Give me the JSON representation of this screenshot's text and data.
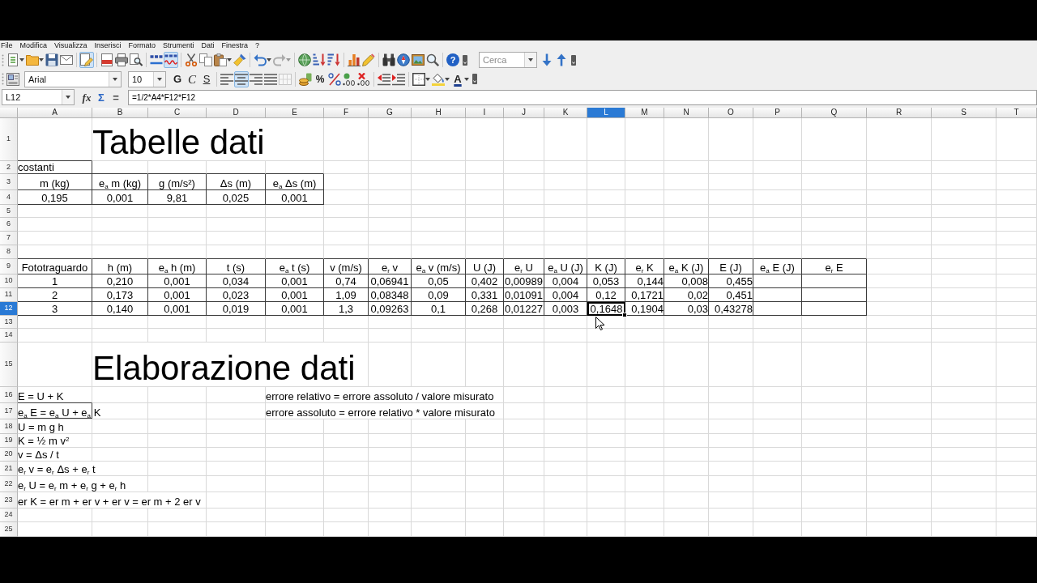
{
  "menu": [
    "File",
    "Modifica",
    "Visualizza",
    "Inserisci",
    "Formato",
    "Strumenti",
    "Dati",
    "Finestra",
    "?"
  ],
  "standard_toolbar": {
    "buttons": [
      {
        "disabled": false
      },
      {
        "disabled": false
      },
      {
        "disabled": false
      },
      {
        "disabled": false
      },
      {
        "on": true,
        "disabled": false
      },
      {
        "disabled": false
      },
      {
        "disabled": false
      },
      {
        "disabled": false
      },
      {
        "disabled": false
      },
      {
        "on": true,
        "disabled": false
      },
      {
        "disabled": false
      },
      {
        "disabled": false
      },
      {
        "disabled": false
      },
      {
        "disabled": false
      },
      {
        "disabled": false
      },
      {
        "disabled": true
      },
      {
        "disabled": false
      },
      {
        "disabled": false
      },
      {
        "disabled": false
      },
      {
        "disabled": false
      },
      {
        "disabled": false
      },
      {
        "disabled": false
      },
      {
        "disabled": false
      },
      {
        "disabled": false
      },
      {
        "disabled": false
      },
      {
        "label": "?",
        "disabled": false
      },
      {
        "disabled": false
      },
      {
        "disabled": false
      }
    ],
    "search": {
      "placeholder": "Cerca"
    }
  },
  "formatting_toolbar": {
    "font_name": "Arial",
    "font_size": "10",
    "buttons": [
      {
        "disabled": false
      },
      {
        "label": "G",
        "on": false,
        "disabled": false
      },
      {
        "label": "C",
        "on": false,
        "disabled": false
      },
      {
        "label": "S",
        "on": false,
        "disabled": false
      },
      {
        "on": false,
        "disabled": false
      },
      {
        "on": true,
        "disabled": false
      },
      {
        "on": false,
        "disabled": false
      },
      {
        "on": false,
        "disabled": false
      },
      {
        "disabled": true
      },
      {
        "disabled": false
      },
      {
        "label": "%",
        "disabled": false
      },
      {
        "disabled": false
      },
      {
        "disabled": false
      },
      {
        "disabled": false
      },
      {
        "disabled": false
      },
      {
        "disabled": false
      },
      {
        "disabled": false
      },
      {
        "disabled": false
      },
      {
        "label": "A",
        "disabled": false
      }
    ]
  },
  "formula_bar": {
    "name_box": "L12",
    "buttons": [
      "fx",
      "Σ",
      "="
    ],
    "formula": "=1/2*A4*F12*F12"
  },
  "sheet": {
    "columns": [
      {
        "label": "A",
        "selected": false
      },
      {
        "label": "B",
        "selected": false
      },
      {
        "label": "C",
        "selected": false
      },
      {
        "label": "D",
        "selected": false
      },
      {
        "label": "E",
        "selected": false
      },
      {
        "label": "F",
        "selected": false
      },
      {
        "label": "G",
        "selected": false
      },
      {
        "label": "H",
        "selected": false
      },
      {
        "label": "I",
        "selected": false
      },
      {
        "label": "J",
        "selected": false
      },
      {
        "label": "K",
        "selected": false
      },
      {
        "label": "L",
        "selected": true
      },
      {
        "label": "M",
        "selected": false
      },
      {
        "label": "N",
        "selected": false
      },
      {
        "label": "O",
        "selected": false
      },
      {
        "label": "P",
        "selected": false
      },
      {
        "label": "Q",
        "selected": false
      },
      {
        "label": "R",
        "selected": false
      },
      {
        "label": "S",
        "selected": false
      },
      {
        "label": "T",
        "selected": false
      }
    ],
    "rows": [
      {
        "label": "1",
        "selected": false,
        "cells": [
          null,
          {
            "text": "Tabelle dati",
            "kind": "title",
            "framed": false,
            "selected": false
          }
        ]
      },
      {
        "label": "2",
        "selected": false,
        "cells": [
          {
            "text": "costanti",
            "kind": "text",
            "framed": true,
            "selected": false
          }
        ]
      },
      {
        "label": "3",
        "selected": false,
        "cells": [
          {
            "text": "m (kg)",
            "kind": "centered",
            "framed": true,
            "selected": false
          },
          {
            "text": "e$_{a}$ m (kg)",
            "kind": "centered",
            "framed": true,
            "selected": false
          },
          {
            "text": "g (m/s²)",
            "kind": "centered",
            "framed": true,
            "selected": false
          },
          {
            "text": "Δs (m)",
            "kind": "centered",
            "framed": true,
            "selected": false
          },
          {
            "text": "e$_{a}$ Δs (m)",
            "kind": "centered",
            "framed": true,
            "selected": false
          }
        ]
      },
      {
        "label": "4",
        "selected": false,
        "cells": [
          {
            "text": "0,195",
            "kind": "centered",
            "framed": true,
            "selected": false
          },
          {
            "text": "0,001",
            "kind": "centered",
            "framed": true,
            "selected": false
          },
          {
            "text": "9,81",
            "kind": "centered",
            "framed": true,
            "selected": false
          },
          {
            "text": "0,025",
            "kind": "centered",
            "framed": true,
            "selected": false
          },
          {
            "text": "0,001",
            "kind": "centered",
            "framed": true,
            "selected": false
          }
        ]
      },
      {
        "label": "5",
        "selected": false
      },
      {
        "label": "6",
        "selected": false
      },
      {
        "label": "7",
        "selected": false
      },
      {
        "label": "8",
        "selected": false
      },
      {
        "label": "9",
        "selected": false,
        "cells": [
          {
            "text": "Fototraguardo",
            "kind": "centered",
            "framed": true,
            "selected": false
          },
          {
            "text": "h (m)",
            "kind": "centered",
            "framed": true,
            "selected": false
          },
          {
            "text": "e$_{a}$ h (m)",
            "kind": "centered",
            "framed": true,
            "selected": false
          },
          {
            "text": "t (s)",
            "kind": "centered",
            "framed": true,
            "selected": false
          },
          {
            "text": "e$_{a}$ t (s)",
            "kind": "centered",
            "framed": true,
            "selected": false
          },
          {
            "text": "v (m/s)",
            "kind": "centered",
            "framed": true,
            "selected": false
          },
          {
            "text": "e$_{r}$ v",
            "kind": "centered",
            "framed": true,
            "selected": false
          },
          {
            "text": "e$_{a}$ v (m/s)",
            "kind": "centered",
            "framed": true,
            "selected": false
          },
          {
            "text": "U (J)",
            "kind": "centered",
            "framed": true,
            "selected": false
          },
          {
            "text": "e$_{r}$ U",
            "kind": "centered",
            "framed": true,
            "selected": false
          },
          {
            "text": "e$_{a}$ U (J)",
            "kind": "centered",
            "framed": true,
            "selected": false
          },
          {
            "text": "K (J)",
            "kind": "centered",
            "framed": true,
            "selected": false
          },
          {
            "text": "e$_{r}$ K",
            "kind": "centered",
            "framed": true,
            "selected": false
          },
          {
            "text": "e$_{a}$ K (J)",
            "kind": "centered",
            "framed": true,
            "selected": false
          },
          {
            "text": "E (J)",
            "kind": "centered",
            "framed": true,
            "selected": false
          },
          {
            "text": "e$_{a}$ E (J)",
            "kind": "centered",
            "framed": true,
            "selected": false
          },
          {
            "text": "e$_{r}$ E",
            "kind": "centered",
            "framed": true,
            "selected": false
          }
        ]
      },
      {
        "label": "10",
        "selected": false,
        "cells": [
          {
            "text": "1",
            "kind": "centered",
            "framed": true,
            "selected": false
          },
          {
            "text": "0,210",
            "kind": "centered",
            "framed": true,
            "selected": false
          },
          {
            "text": "0,001",
            "kind": "centered",
            "framed": true,
            "selected": false
          },
          {
            "text": "0,034",
            "kind": "centered",
            "framed": true,
            "selected": false
          },
          {
            "text": "0,001",
            "kind": "centered",
            "framed": true,
            "selected": false
          },
          {
            "text": "0,74",
            "kind": "centered",
            "framed": true,
            "selected": false
          },
          {
            "text": "0,06941",
            "kind": "centered",
            "framed": true,
            "selected": false
          },
          {
            "text": "0,05",
            "kind": "centered",
            "framed": true,
            "selected": false
          },
          {
            "text": "0,402",
            "kind": "centered",
            "framed": true,
            "selected": false
          },
          {
            "text": "0,00989",
            "kind": "centered",
            "framed": true,
            "selected": false
          },
          {
            "text": "0,004",
            "kind": "centered",
            "framed": true,
            "selected": false
          },
          {
            "text": "0,053",
            "kind": "centered",
            "framed": true,
            "selected": false
          },
          {
            "text": "0,144",
            "kind": "number",
            "framed": true,
            "selected": false
          },
          {
            "text": "0,008",
            "kind": "number",
            "framed": true,
            "selected": false
          },
          {
            "text": "0,455",
            "kind": "number",
            "framed": true,
            "selected": false
          },
          {
            "framed": true,
            "selected": false
          },
          {
            "framed": true,
            "selected": false
          }
        ]
      },
      {
        "label": "11",
        "selected": false,
        "cells": [
          {
            "text": "2",
            "kind": "centered",
            "framed": true,
            "selected": false
          },
          {
            "text": "0,173",
            "kind": "centered",
            "framed": true,
            "selected": false
          },
          {
            "text": "0,001",
            "kind": "centered",
            "framed": true,
            "selected": false
          },
          {
            "text": "0,023",
            "kind": "centered",
            "framed": true,
            "selected": false
          },
          {
            "text": "0,001",
            "kind": "centered",
            "framed": true,
            "selected": false
          },
          {
            "text": "1,09",
            "kind": "centered",
            "framed": true,
            "selected": false
          },
          {
            "text": "0,08348",
            "kind": "centered",
            "framed": true,
            "selected": false
          },
          {
            "text": "0,09",
            "kind": "centered",
            "framed": true,
            "selected": false
          },
          {
            "text": "0,331",
            "kind": "centered",
            "framed": true,
            "selected": false
          },
          {
            "text": "0,01091",
            "kind": "centered",
            "framed": true,
            "selected": false
          },
          {
            "text": "0,004",
            "kind": "centered",
            "framed": true,
            "selected": false
          },
          {
            "text": "0,12",
            "kind": "centered",
            "framed": true,
            "selected": false
          },
          {
            "text": "0,1721",
            "kind": "number",
            "framed": true,
            "selected": false
          },
          {
            "text": "0,02",
            "kind": "number",
            "framed": true,
            "selected": false
          },
          {
            "text": "0,451",
            "kind": "number",
            "framed": true,
            "selected": false
          },
          {
            "framed": true,
            "selected": false
          },
          {
            "framed": true,
            "selected": false
          }
        ]
      },
      {
        "label": "12",
        "selected": true,
        "cells": [
          {
            "text": "3",
            "kind": "centered",
            "framed": true,
            "selected": false
          },
          {
            "text": "0,140",
            "kind": "centered",
            "framed": true,
            "selected": false
          },
          {
            "text": "0,001",
            "kind": "centered",
            "framed": true,
            "selected": false
          },
          {
            "text": "0,019",
            "kind": "centered",
            "framed": true,
            "selected": false
          },
          {
            "text": "0,001",
            "kind": "centered",
            "framed": true,
            "selected": false
          },
          {
            "text": "1,3",
            "kind": "centered",
            "framed": true,
            "selected": false
          },
          {
            "text": "0,09263",
            "kind": "centered",
            "framed": true,
            "selected": false
          },
          {
            "text": "0,1",
            "kind": "centered",
            "framed": true,
            "selected": false
          },
          {
            "text": "0,268",
            "kind": "centered",
            "framed": true,
            "selected": false
          },
          {
            "text": "0,01227",
            "kind": "centered",
            "framed": true,
            "selected": false
          },
          {
            "text": "0,003",
            "kind": "centered",
            "framed": true,
            "selected": false
          },
          {
            "text": "0,1648",
            "kind": "centered",
            "framed": true,
            "selected": true
          },
          {
            "text": "0,1904",
            "kind": "number",
            "framed": true,
            "selected": false
          },
          {
            "text": "0,03",
            "kind": "number",
            "framed": true,
            "selected": false
          },
          {
            "text": "0,43278",
            "kind": "number",
            "framed": true,
            "selected": false
          },
          {
            "framed": true,
            "selected": false
          },
          {
            "framed": true,
            "selected": false
          }
        ]
      },
      {
        "label": "13",
        "selected": false
      },
      {
        "label": "14",
        "selected": false
      },
      {
        "label": "15",
        "selected": false,
        "cells": [
          null,
          {
            "text": "Elaborazione dati",
            "kind": "title",
            "framed": false,
            "selected": false
          }
        ]
      },
      {
        "label": "16",
        "selected": false,
        "cells": [
          {
            "text": "E = U + K",
            "kind": "text",
            "framed": false,
            "selected": false
          },
          null,
          null,
          null,
          {
            "text": "errore relativo = errore assoluto / valore misurato",
            "kind": "text",
            "framed": false,
            "selected": false
          }
        ]
      },
      {
        "label": "17",
        "selected": false,
        "cells": [
          {
            "text": "e$_{a}$ E = e$_{a}$ U + e$_{a}$ K",
            "kind": "text",
            "framed": true,
            "selected": false
          },
          null,
          null,
          null,
          {
            "text": "errore assoluto = errore relativo * valore misurato",
            "kind": "text",
            "framed": false,
            "selected": false
          }
        ]
      },
      {
        "label": "18",
        "selected": false,
        "cells": [
          {
            "text": "U = m g h",
            "kind": "text",
            "framed": false,
            "selected": false
          }
        ]
      },
      {
        "label": "19",
        "selected": false,
        "cells": [
          {
            "text": "K = ½ m v$^{2}$",
            "kind": "text",
            "framed": false,
            "selected": false
          }
        ]
      },
      {
        "label": "20",
        "selected": false,
        "cells": [
          {
            "text": "v = Δs / t",
            "kind": "text",
            "framed": false,
            "selected": false
          }
        ]
      },
      {
        "label": "21",
        "selected": false,
        "cells": [
          {
            "text": "e$_{r}$ v = e$_{r}$ Δs + e$_{r}$ t",
            "kind": "text",
            "framed": false,
            "selected": false
          }
        ]
      },
      {
        "label": "22",
        "selected": false,
        "cells": [
          {
            "text": "e$_{r}$ U = e$_{r}$ m + e$_{r}$ g + e$_{r}$ h",
            "kind": "text",
            "framed": false,
            "selected": false
          }
        ]
      },
      {
        "label": "23",
        "selected": false,
        "cells": [
          {
            "text": "er K = er m + er v + er v = er m + 2 er v",
            "kind": "text",
            "framed": false,
            "selected": false
          }
        ]
      },
      {
        "label": "24",
        "selected": false
      },
      {
        "label": "25",
        "selected": false
      }
    ]
  }
}
